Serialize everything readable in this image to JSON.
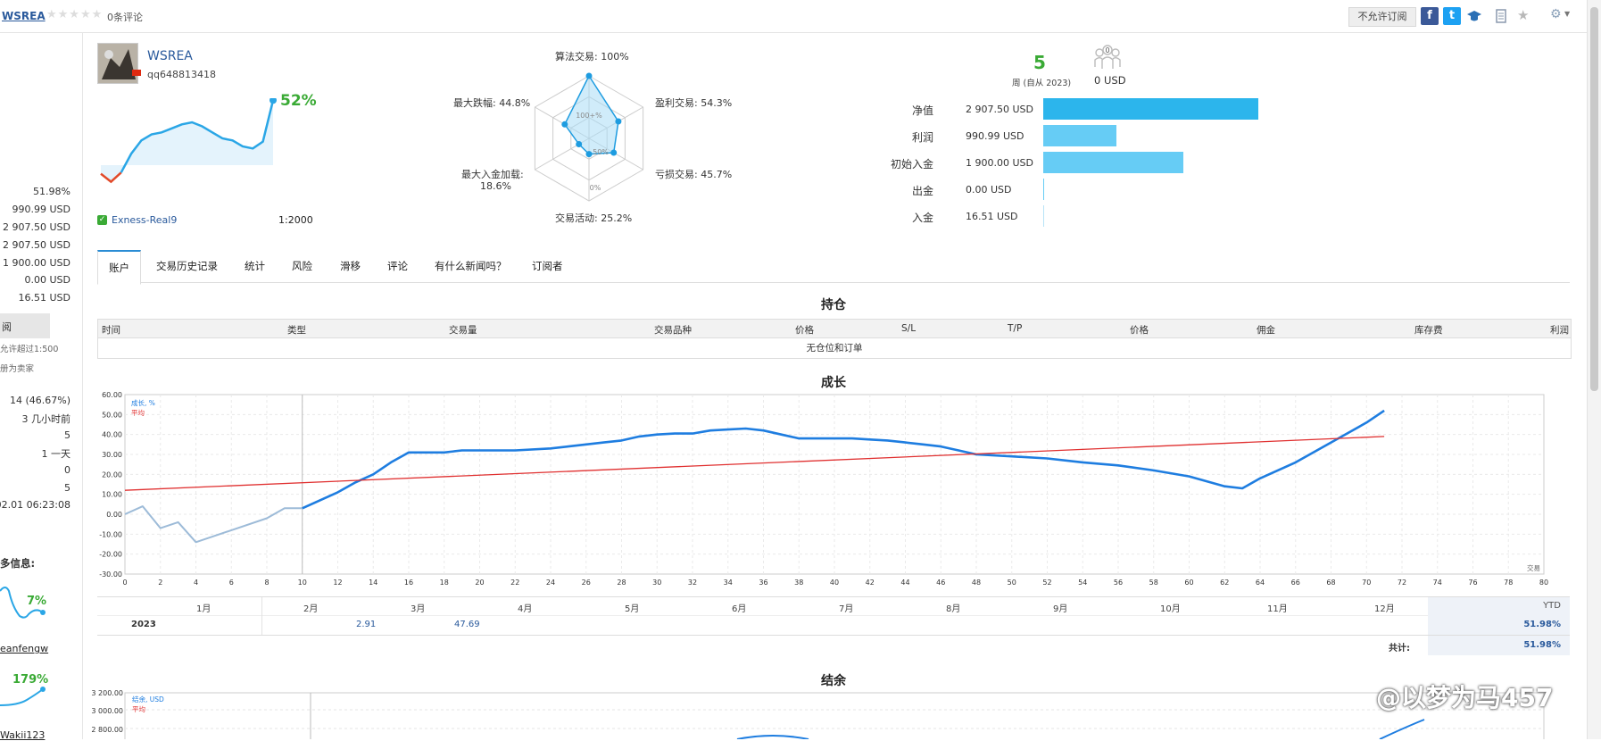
{
  "header": {
    "signal_name": "WSREA",
    "stars": "★★★★★",
    "reviews": "0条评论",
    "subscribe_button": "不允许订阅",
    "share_facebook": "f",
    "share_twitter": "t"
  },
  "sidebar": {
    "values": [
      "51.98%",
      "990.99 USD",
      "2 907.50 USD",
      "2 907.50 USD",
      "1 900.00 USD",
      "0.00 USD",
      "16.51 USD"
    ],
    "box_label": "阅",
    "leverage_note": "允许超过1:500",
    "register_note": "册为卖家",
    "stats": [
      "14 (46.67%)",
      "3 几小时前",
      "5",
      "1 一天",
      "0",
      "5",
      ".02.01 06:23:08"
    ],
    "more_info": "多信息:",
    "mini1_pct": "7%",
    "mini1_name": "eanfengw",
    "mini2_pct": "179%",
    "mini2_name": "Wakii123"
  },
  "profile": {
    "name": "WSREA",
    "user": "qq648813418",
    "growth": "52%",
    "broker": "Exness-Real9",
    "leverage": "1:2000",
    "growth_curve": [
      -0.28,
      -0.48,
      -0.25,
      0.22,
      0.55,
      0.7,
      0.75,
      0.85,
      0.95,
      1.0,
      0.9,
      0.75,
      0.6,
      0.55,
      0.4,
      0.35,
      0.52,
      1.55
    ]
  },
  "radar": {
    "axis_labels": [
      "算法交易: 100%",
      "盈利交易: 54.3%",
      "亏损交易: 45.7%",
      "交易活动: 25.2%",
      "最大入金加载:",
      "18.6%",
      "最大跌幅: 44.8%"
    ],
    "scale_labels": [
      "100+%",
      "50%",
      "0%"
    ],
    "values": [
      100,
      54.3,
      45.7,
      25.2,
      18.6,
      44.8
    ]
  },
  "summary": {
    "weeks": "5",
    "weeks_label": "周 (自从 2023)",
    "subscribers": "0",
    "subscribers_value": "0 USD"
  },
  "bars": {
    "max": 2907.5,
    "items": [
      {
        "label": "净值",
        "text": "2 907.50 USD",
        "value": 2907.5,
        "color": "#2cb5ec"
      },
      {
        "label": "利润",
        "text": "990.99 USD",
        "value": 990.99,
        "color": "#66ccf5"
      },
      {
        "label": "初始入金",
        "text": "1 900.00 USD",
        "value": 1900.0,
        "color": "#66ccf5"
      },
      {
        "label": "出金",
        "text": "0.00 USD",
        "value": 0,
        "color": "#66ccf5"
      },
      {
        "label": "入金",
        "text": "16.51 USD",
        "value": 16.51,
        "color": "#66ccf5"
      }
    ]
  },
  "tabs": [
    "账户",
    "交易历史记录",
    "统计",
    "风险",
    "滑移",
    "评论",
    "有什么新闻吗？",
    "订阅者"
  ],
  "positions": {
    "title": "持仓",
    "columns": [
      "时间",
      "类型",
      "交易量",
      "交易品种",
      "价格",
      "S/L",
      "T/P",
      "价格",
      "佣金",
      "库存费",
      "利润"
    ],
    "empty_text": "无仓位和订单"
  },
  "chart_data": [
    {
      "type": "line",
      "title": "成长",
      "xlabel": "交易",
      "xlim": [
        0,
        80
      ],
      "ylim": [
        -30,
        60
      ],
      "x_ticks": [
        0,
        2,
        4,
        6,
        8,
        10,
        12,
        14,
        16,
        18,
        20,
        22,
        24,
        26,
        28,
        30,
        32,
        34,
        36,
        38,
        40,
        42,
        44,
        46,
        48,
        50,
        52,
        54,
        56,
        58,
        60,
        62,
        64,
        66,
        68,
        70,
        72,
        74,
        76,
        78,
        80
      ],
      "y_ticks": [
        "60.00",
        "50.00",
        "40.00",
        "30.00",
        "20.00",
        "10.00",
        "0.00",
        "-10.00",
        "-20.00",
        "-30.00"
      ],
      "legend": [
        "成长, %",
        "平均"
      ],
      "series": [
        {
          "name": "成长, %",
          "color": "#9dbbd8",
          "x": [
            0,
            1,
            2,
            3,
            4,
            6,
            8,
            9,
            10
          ],
          "y": [
            0,
            4,
            -7,
            -4,
            -14,
            -8,
            -2,
            3,
            3
          ]
        },
        {
          "name": "成长, %",
          "color": "#1e7de0",
          "x": [
            10,
            12,
            13,
            14,
            15,
            16,
            18,
            19,
            20,
            22,
            24,
            25,
            26,
            27,
            28,
            29,
            30,
            31,
            32,
            33,
            34,
            35,
            36,
            37,
            38,
            39,
            40,
            41,
            42,
            43,
            44,
            45,
            46,
            47,
            48,
            50,
            52,
            54,
            56,
            58,
            60,
            62,
            63,
            64,
            66,
            68,
            70,
            71
          ],
          "y": [
            3,
            11,
            16,
            20,
            26,
            31,
            31,
            32,
            32,
            32,
            33,
            34,
            35,
            36,
            37,
            39,
            40,
            40.5,
            40.5,
            42,
            42.5,
            43,
            42,
            40,
            38,
            38,
            38,
            38,
            37.5,
            37,
            36,
            35,
            34,
            32,
            30,
            29,
            28,
            26,
            24.5,
            22,
            19,
            14,
            13,
            18,
            26,
            36,
            46,
            52
          ]
        },
        {
          "name": "平均",
          "color": "#e03030",
          "x": [
            0,
            71
          ],
          "y": [
            12,
            39
          ]
        }
      ],
      "months": [
        "1月",
        "2月",
        "3月",
        "4月",
        "5月",
        "6月",
        "7月",
        "8月",
        "9月",
        "10月",
        "11月",
        "12月"
      ],
      "year": "2023",
      "month_values": [
        "2.91",
        "47.69"
      ],
      "ytd_label": "YTD",
      "ytd_value": "51.98%",
      "total_label": "共计:",
      "total_value": "51.98%"
    },
    {
      "type": "line",
      "title": "结余",
      "y_ticks": [
        "3 200.00",
        "3 000.00",
        "2 800.00"
      ],
      "legend": [
        "结余, USD",
        "平均"
      ]
    }
  ],
  "watermark": "@以梦为马457"
}
